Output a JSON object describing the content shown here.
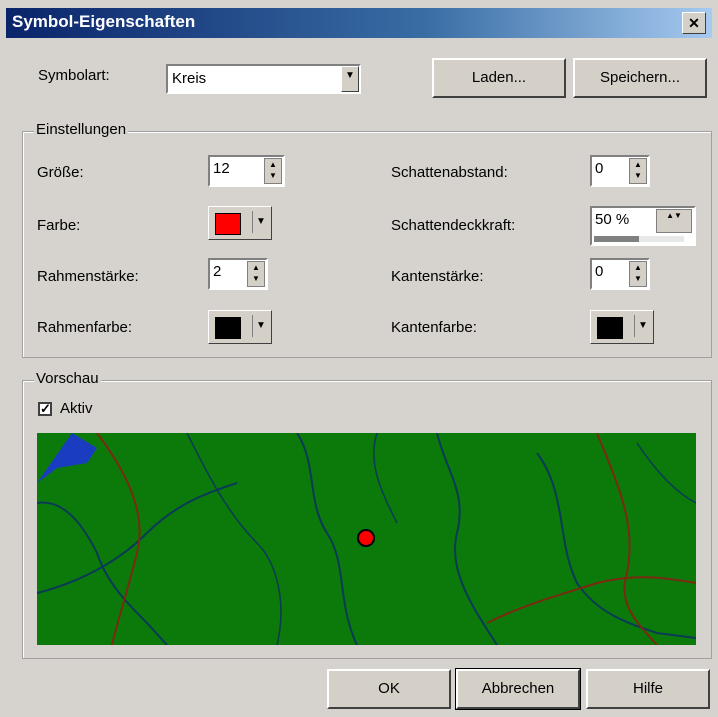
{
  "window": {
    "title": "Symbol-Eigenschaften",
    "close_symbol": "✕"
  },
  "top": {
    "symbolart_label": "Symbolart:",
    "symbolart_value": "Kreis",
    "load_button": "Laden...",
    "save_button": "Speichern..."
  },
  "settings": {
    "group_title": "Einstellungen",
    "groesse_label": "Größe:",
    "groesse_value": "12",
    "farbe_label": "Farbe:",
    "farbe_color": "#ff0000",
    "rahmenstaerke_label": "Rahmenstärke:",
    "rahmenstaerke_value": "2",
    "rahmenfarbe_label": "Rahmenfarbe:",
    "rahmenfarbe_color": "#000000",
    "schattenabstand_label": "Schattenabstand:",
    "schattenabstand_value": "0",
    "schattendeckkraft_label": "Schattendeckkraft:",
    "schattendeckkraft_value": "50 %",
    "schattendeckkraft_level": 0.5,
    "kantenstaerke_label": "Kantenstärke:",
    "kantenstaerke_value": "0",
    "kantenfarbe_label": "Kantenfarbe:",
    "kantenfarbe_color": "#000000"
  },
  "preview": {
    "group_title": "Vorschau",
    "aktiv_label": "Aktiv",
    "aktiv_checked": true,
    "map_color": "#0b7a0b",
    "symbol_color": "#ff0000"
  },
  "footer": {
    "ok_button": "OK",
    "cancel_button": "Abbrechen",
    "help_button": "Hilfe"
  }
}
